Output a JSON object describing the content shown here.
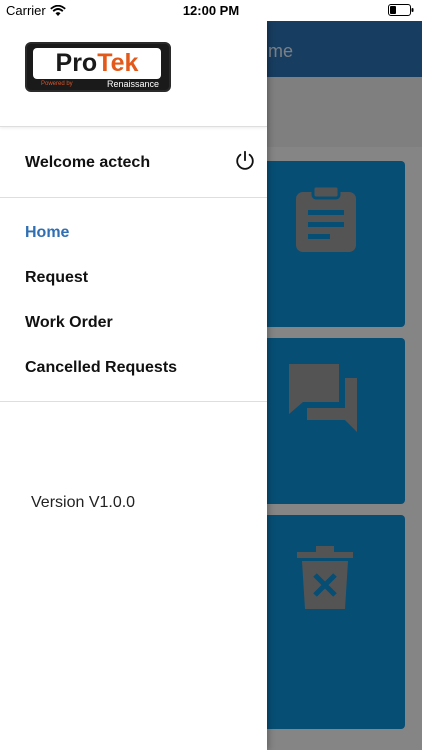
{
  "status_bar": {
    "carrier": "Carrier",
    "time": "12:00 PM",
    "wifi_icon": "wifi-icon",
    "battery_icon": "battery-icon"
  },
  "background": {
    "header_title": "me",
    "header_color": "#2a6fb0",
    "tile_color": "#0d8fd6",
    "tiles": [
      {
        "icon": "clipboard-icon"
      },
      {
        "icon": "chat-bubbles-icon"
      },
      {
        "icon": "trash-cancel-icon"
      }
    ]
  },
  "drawer": {
    "logo": {
      "pro": "Pro",
      "tek": "Tek",
      "powered_by": "Powered by",
      "company": "Renaissance"
    },
    "welcome": "Welcome actech",
    "power_icon": "power-icon",
    "menu": [
      {
        "label": "Home",
        "active": true
      },
      {
        "label": "Request",
        "active": false
      },
      {
        "label": "Work Order",
        "active": false
      },
      {
        "label": "Cancelled Requests",
        "active": false
      }
    ],
    "version": "Version V1.0.0",
    "active_color": "#2f6fb3"
  }
}
